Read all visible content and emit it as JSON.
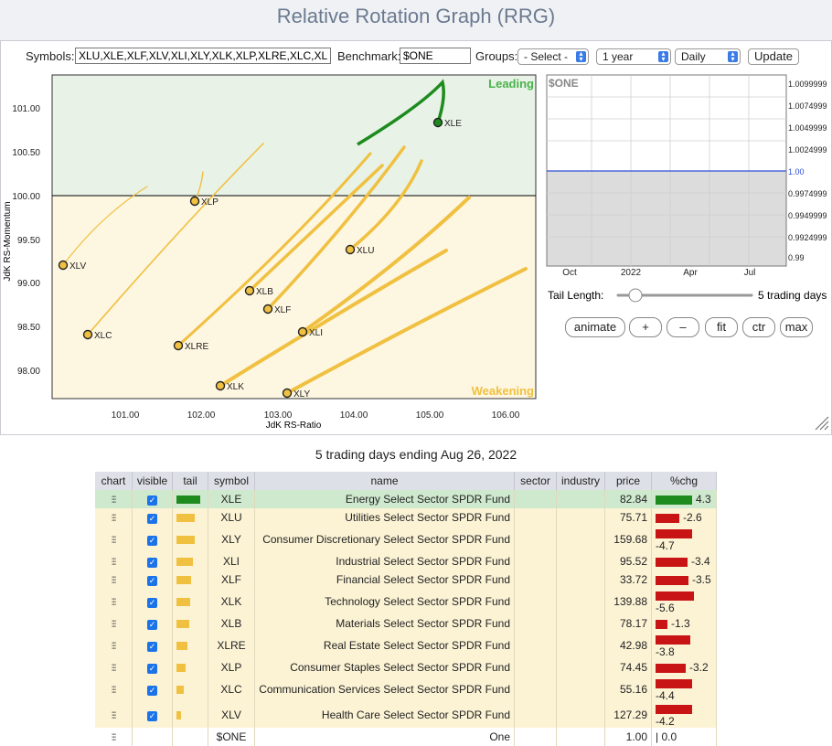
{
  "title": "Relative Rotation Graph (RRG)",
  "controls": {
    "symbols_label": "Symbols:",
    "symbols_value": "XLU,XLE,XLF,XLV,XLI,XLY,XLK,XLP,XLRE,XLC,XLB",
    "benchmark_label": "Benchmark:",
    "benchmark_value": "$ONE",
    "groups_label": "Groups:",
    "groups_value": "- Select -",
    "range_value": "1 year",
    "period_value": "Daily",
    "update_label": "Update"
  },
  "rrg": {
    "quadrants": {
      "leading": "Leading",
      "weakening": "Weakening"
    },
    "x_axis_label": "JdK RS-Ratio",
    "y_axis_label": "JdK RS-Momentum",
    "x_ticks": [
      "101.00",
      "102.00",
      "103.00",
      "104.00",
      "105.00",
      "106.00"
    ],
    "y_ticks": [
      "101.00",
      "100.50",
      "100.00",
      "99.50",
      "99.00",
      "98.50",
      "98.00"
    ],
    "colors": {
      "leading": "#1e8b1e",
      "weakening": "#f0c040",
      "leading_bg": "#e8f2e7",
      "weakening_bg": "#fdf6e1"
    },
    "symbols": [
      "XLE",
      "XLP",
      "XLU",
      "XLB",
      "XLF",
      "XLI",
      "XLK",
      "XLY",
      "XLV",
      "XLC",
      "XLRE"
    ]
  },
  "benchmark_chart": {
    "label": "$ONE",
    "y_ticks": [
      "1.0099999",
      "1.0074999",
      "1.0049999",
      "1.0024999",
      "1.00",
      "0.9974999",
      "0.9949999",
      "0.9924999",
      "0.99"
    ],
    "x_ticks": [
      "Oct",
      "2022",
      "Apr",
      "Jul"
    ]
  },
  "tail": {
    "label": "Tail Length:",
    "value": "5 trading days"
  },
  "buttons": {
    "animate": "animate",
    "plus": "+",
    "minus": "–",
    "fit": "fit",
    "ctr": "ctr",
    "max": "max"
  },
  "table": {
    "caption": "5 trading days ending Aug 26, 2022",
    "headers": [
      "chart",
      "visible",
      "tail",
      "symbol",
      "name",
      "sector",
      "industry",
      "price",
      "%chg"
    ],
    "rows": [
      {
        "symbol": "XLE",
        "name": "Energy Select Sector SPDR Fund",
        "price": "82.84",
        "chg": "4.3",
        "tail": 26,
        "bar": 40,
        "up": true
      },
      {
        "symbol": "XLU",
        "name": "Utilities Select Sector SPDR Fund",
        "price": "75.71",
        "chg": "-2.6",
        "tail": 20,
        "bar": 26,
        "up": false
      },
      {
        "symbol": "XLY",
        "name": "Consumer Discretionary Select Sector SPDR Fund",
        "price": "159.68",
        "chg": "-4.7",
        "tail": 20,
        "bar": 40,
        "up": false
      },
      {
        "symbol": "XLI",
        "name": "Industrial Select Sector SPDR Fund",
        "price": "95.52",
        "chg": "-3.4",
        "tail": 18,
        "bar": 35,
        "up": false
      },
      {
        "symbol": "XLF",
        "name": "Financial Select Sector SPDR Fund",
        "price": "33.72",
        "chg": "-3.5",
        "tail": 16,
        "bar": 36,
        "up": false
      },
      {
        "symbol": "XLK",
        "name": "Technology Select Sector SPDR Fund",
        "price": "139.88",
        "chg": "-5.6",
        "tail": 15,
        "bar": 42,
        "up": false
      },
      {
        "symbol": "XLB",
        "name": "Materials Select Sector SPDR Fund",
        "price": "78.17",
        "chg": "-1.3",
        "tail": 14,
        "bar": 13,
        "up": false
      },
      {
        "symbol": "XLRE",
        "name": "Real Estate Select Sector SPDR Fund",
        "price": "42.98",
        "chg": "-3.8",
        "tail": 12,
        "bar": 38,
        "up": false
      },
      {
        "symbol": "XLP",
        "name": "Consumer Staples Select Sector SPDR Fund",
        "price": "74.45",
        "chg": "-3.2",
        "tail": 10,
        "bar": 33,
        "up": false
      },
      {
        "symbol": "XLC",
        "name": "Communication Services Select Sector SPDR Fund",
        "price": "55.16",
        "chg": "-4.4",
        "tail": 8,
        "bar": 40,
        "up": false
      },
      {
        "symbol": "XLV",
        "name": "Health Care Select Sector SPDR Fund",
        "price": "127.29",
        "chg": "-4.2",
        "tail": 5,
        "bar": 40,
        "up": false
      }
    ],
    "benchmark_row": {
      "symbol": "$ONE",
      "name": "One",
      "price": "1.00",
      "chg": "0.0"
    }
  }
}
